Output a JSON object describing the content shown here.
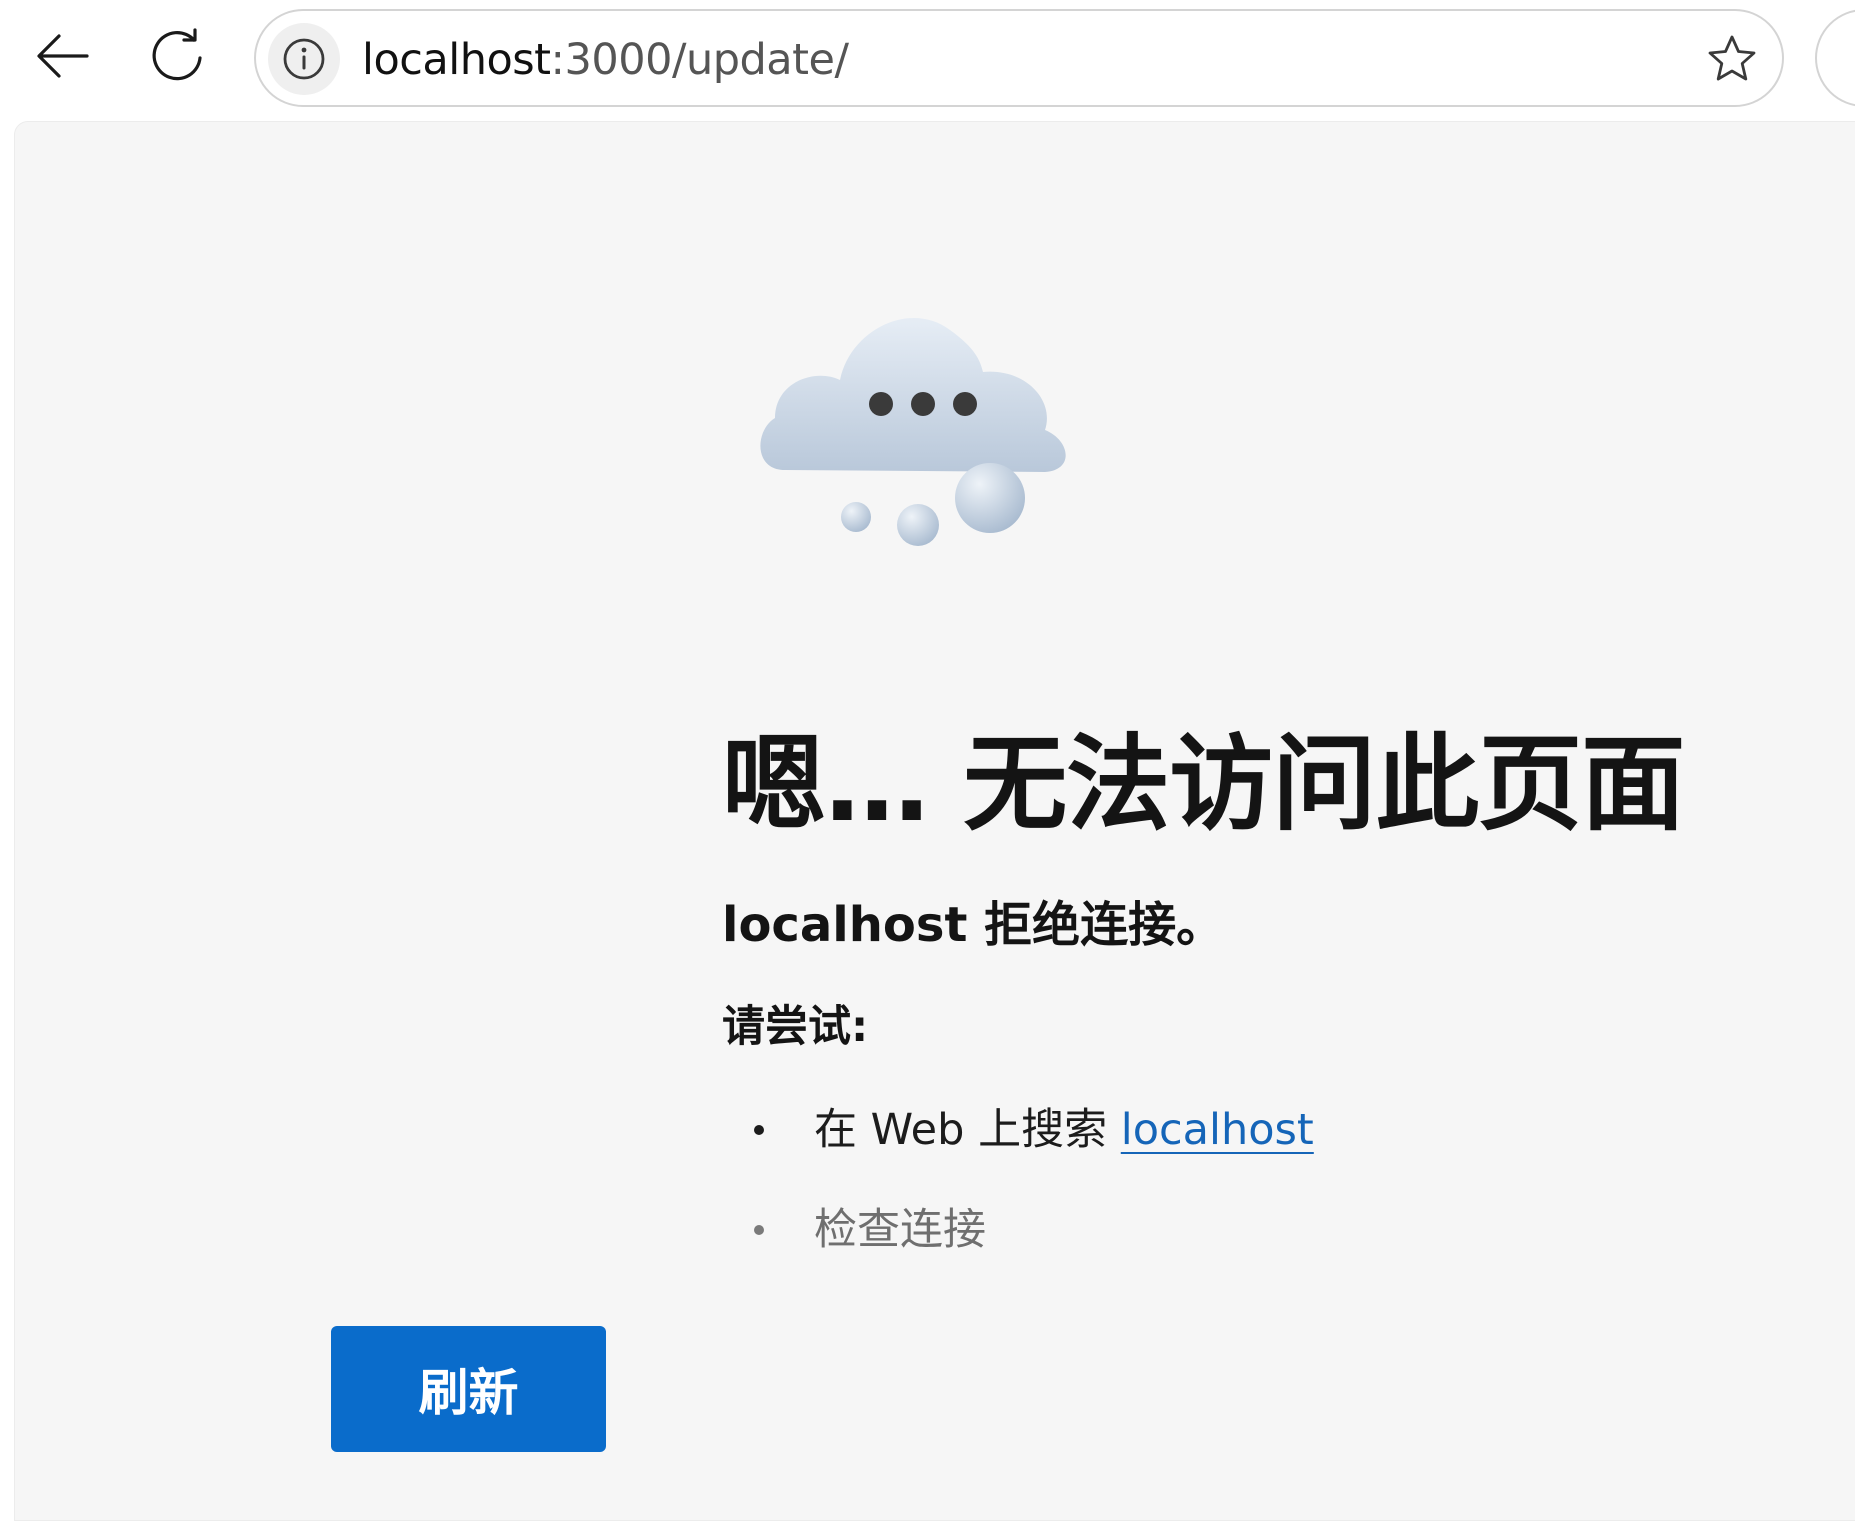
{
  "toolbar": {
    "url": {
      "host": "localhost",
      "rest": ":3000/update/"
    }
  },
  "error_page": {
    "title": "嗯… 无法访问此页面",
    "subtitle": "localhost 拒绝连接。",
    "try_label": "请尝试:",
    "suggestions": [
      {
        "prefix": "在 Web 上搜索 ",
        "link": "localhost"
      },
      {
        "text": "检查连接"
      }
    ],
    "refresh_label": "刷新"
  },
  "colors": {
    "accent": "#0a6ccb",
    "link": "#1565b8",
    "page_background": "#f6f6f6"
  },
  "icons": {
    "back": "back-arrow-icon",
    "reload": "reload-icon",
    "site_info": "info-icon",
    "favorite": "star-icon",
    "illustration": "cloud-icon"
  }
}
